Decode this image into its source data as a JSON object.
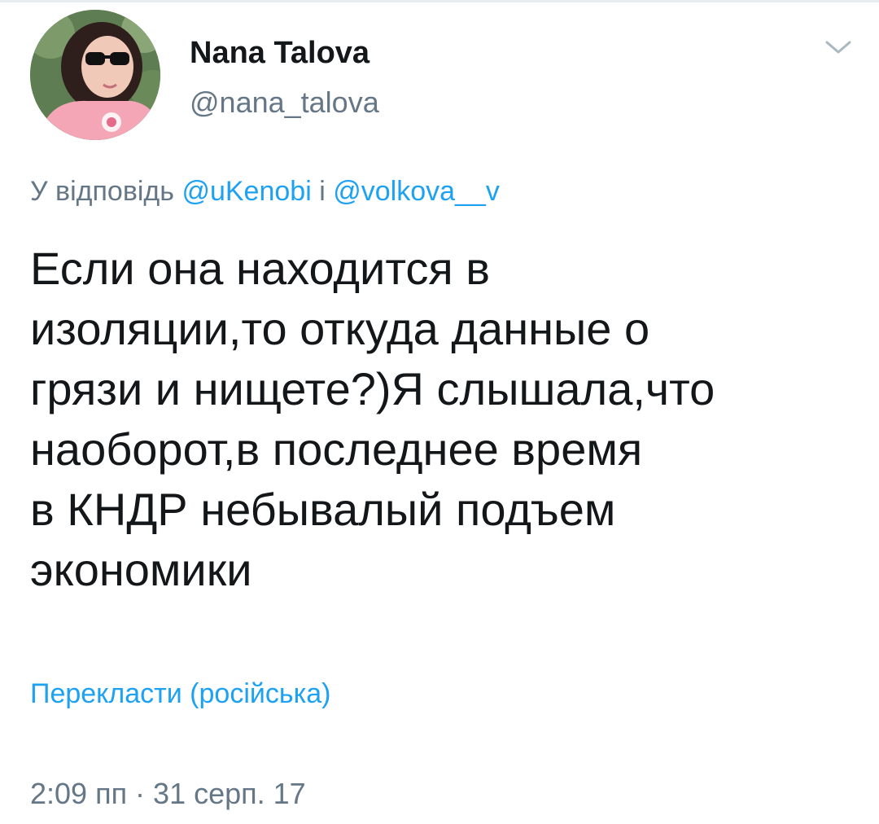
{
  "author": {
    "name": "Nana Talova",
    "handle": "@nana_talova"
  },
  "reply": {
    "prefix": "У відповідь",
    "mention_1": "@uKenobi",
    "connector": "і",
    "mention_2": "@volkova__v"
  },
  "tweet": {
    "lines": [
      "Если она находится в",
      "изоляции,то откуда данные о",
      "грязи и нищете?)Я слышала,что",
      "наоборот,в последнее время",
      "в КНДР небывалый подъем",
      "экономики"
    ]
  },
  "translate_label": "Перекласти (російська)",
  "timestamp": "2:09 пп · 31 серп. 17",
  "icons": {
    "avatar": "profile-photo",
    "menu": "chevron-down-icon"
  },
  "colors": {
    "text": "#14171a",
    "secondary": "#657786",
    "link": "#1da1f2"
  }
}
